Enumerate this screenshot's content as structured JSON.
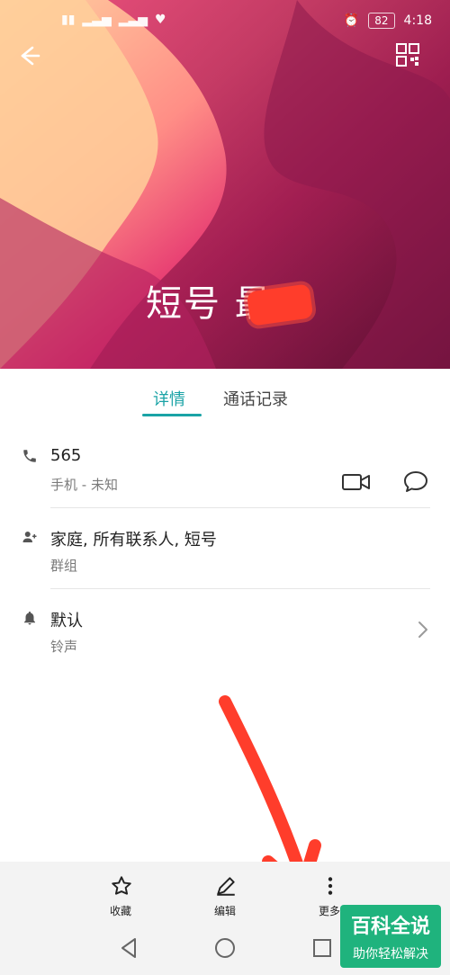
{
  "status": {
    "left_icons": [
      "sim1-hd-icon",
      "signal-icon",
      "signal-4g-icon",
      "heart-icon"
    ],
    "alarm_icon": "alarm-icon",
    "battery": "82",
    "time": "4:18"
  },
  "header": {
    "contact_name": "短号 最"
  },
  "tabs": {
    "details": "详情",
    "call_log": "通话记录"
  },
  "contact": {
    "phone": {
      "number": "565",
      "label": "手机 - 未知"
    },
    "groups": {
      "value": "家庭, 所有联系人, 短号",
      "label": "群组"
    },
    "ringtone": {
      "value": "默认",
      "label": "铃声"
    }
  },
  "actions": {
    "favorite": "收藏",
    "edit": "编辑",
    "more": "更多"
  },
  "colors": {
    "accent": "#1aa3a6",
    "annotation": "#ff3d2b"
  },
  "watermark": {
    "title": "百科全说",
    "subtitle": "助你轻松解决"
  }
}
